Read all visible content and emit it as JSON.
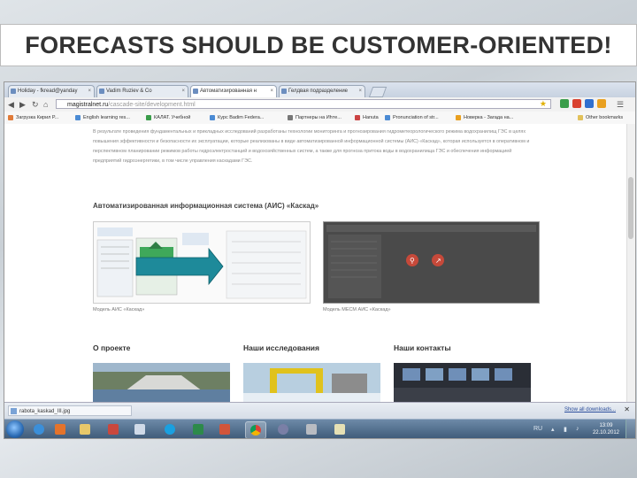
{
  "slide": {
    "title": "FORECASTS SHOULD BE CUSTOMER-ORIENTED!"
  },
  "browser": {
    "tabs": [
      {
        "label": "Holiday - fkread@yanday"
      },
      {
        "label": "Vadim Ruziev & Co"
      },
      {
        "label": "Автоматизированная н"
      },
      {
        "label": "Гелдвая подразделение"
      }
    ],
    "url_host": "magistralnet.ru",
    "url_path": "/cascade-site/development.html",
    "bookmarks": [
      "Загрузка Кирил Р...",
      "English learning res...",
      "КАЛАТ. Учебной",
      "Курс Вadim Federa...",
      "Партнеры на Иhте...",
      "Hanuta",
      "Pronunciation of str...",
      "Новерка - Загада на...",
      "Other bookmarks"
    ]
  },
  "page": {
    "intro": "В результате проведения фундаментальных и прикладных исследований разработаны технологии мониторинга и прогнозирования гидрометеорологического режима водохранилищ ГЭС в целях повышения эффективности и безопасности их эксплуатации, которые реализованы в виде автоматизированной информационной системы (АИС) «Каскад», которая используется в оперативном и перспективном планировании режимов работы гидроэлектростанций и водохозяйственных систем, а также для прогноза притока воды в водохранилища ГЭС и обеспечения информацией предприятий гидроэнергетики, в том числе управления каскадами ГЭС.",
    "section_title": "Автоматизированная информационная система (АИС) «Каскад»",
    "caption_left": "Модель АИС «Каскад»",
    "caption_right": "Модель МЕСМ АИС «Каскад»",
    "columns": [
      {
        "title": "О проекте"
      },
      {
        "title": "Наши исследования"
      },
      {
        "title": "Наши контакты"
      }
    ]
  },
  "downloads": {
    "file": "rabota_kaskad_III.jpg",
    "show_all": "Show all downloads..."
  },
  "taskbar": {
    "time": "13:09",
    "date": "22.10.2012"
  }
}
